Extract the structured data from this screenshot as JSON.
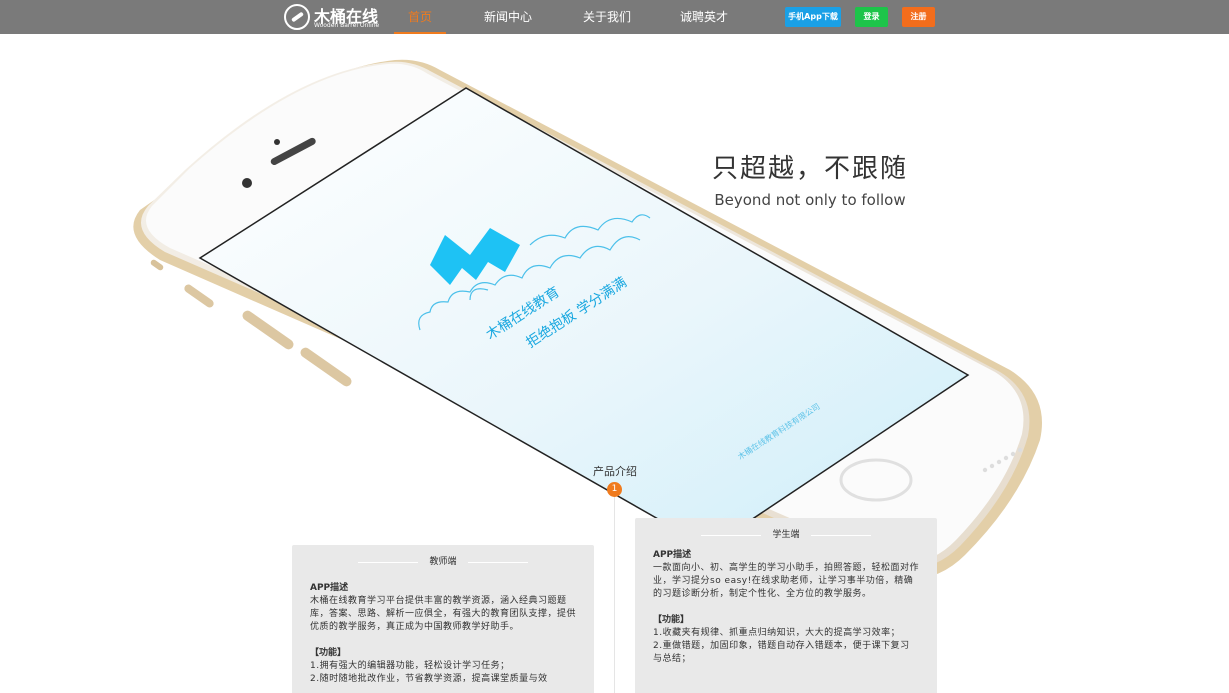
{
  "nav": {
    "logo_name": "木桶在线",
    "logo_sub": "Wooden Barrel Online",
    "items": [
      {
        "label": "首页",
        "active": true
      },
      {
        "label": "新闻中心",
        "active": false
      },
      {
        "label": "关于我们",
        "active": false
      },
      {
        "label": "诚聘英才",
        "active": false
      }
    ],
    "download_label": "手机App下载",
    "login_label": "登录",
    "register_label": "注册",
    "colors": {
      "bar": "#7a7a7a",
      "active": "#f07b1e",
      "download": "#1aa0e6",
      "login": "#1dc44a",
      "register": "#f36d1c"
    }
  },
  "phone": {
    "screen_line1": "木桶在线教育",
    "screen_line2": "拒绝抱板 学分满满",
    "screen_footer": "木桶在线教育科技有限公司"
  },
  "hero": {
    "slogan_cn": "只超越，不跟随",
    "slogan_en": "Beyond not only to follow"
  },
  "intro": {
    "title": "产品介绍",
    "index": "1"
  },
  "teacher": {
    "title": "教师端",
    "desc_heading": "APP描述",
    "desc_text": "木桶在线教育学习平台提供丰富的教学资源，涵入经典习题题库，答案、思路、解析一应俱全，有强大的教育团队支撑，提供优质的教学服务，真正成为中国教师教学好助手。",
    "feature_heading": "【功能】",
    "features": [
      "1.拥有强大的编辑器功能，轻松设计学习任务；",
      "2.随时随地批改作业，节省教学资源，提高课堂质量与效"
    ]
  },
  "student": {
    "title": "学生端",
    "desc_heading": "APP描述",
    "desc_text": "一款面向小、初、高学生的学习小助手，拍照答题，轻松面对作业，学习提分so easy!在线求助老师，让学习事半功倍，精确的习题诊断分析，制定个性化、全方位的教学服务。",
    "feature_heading": "【功能】",
    "features": [
      "1.收藏夹有规律、抓重点归纳知识，大大的提高学习效率；",
      "2.重做错题，加固印象，错题自动存入错题本，便于课下复习与总结；"
    ]
  }
}
